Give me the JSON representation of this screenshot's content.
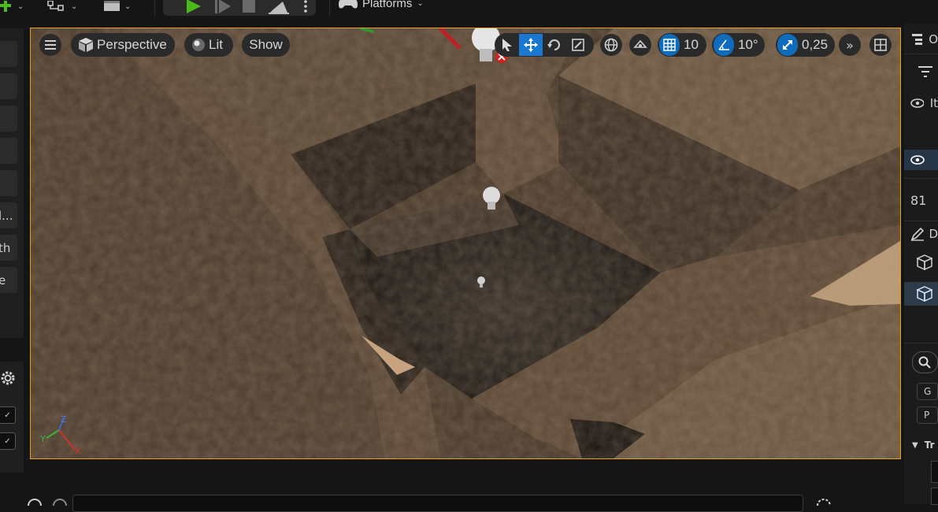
{
  "toolbar": {
    "platforms_label": "Platforms"
  },
  "viewport": {
    "view_mode": "Perspective",
    "lighting_mode": "Lit",
    "show_label": "Show",
    "grid_snap_value": "10",
    "rotation_snap_value": "10°",
    "scale_snap_value": "0,25",
    "axis_labels": {
      "x": "X",
      "y": "Y",
      "z": "Z"
    }
  },
  "left_panel": {
    "items": [
      {
        "label": ""
      },
      {
        "label": ""
      },
      {
        "label": ""
      },
      {
        "label": ""
      },
      {
        "label": ""
      },
      {
        "label": "l..."
      },
      {
        "label": "th"
      },
      {
        "label": "e"
      }
    ]
  },
  "right_panel": {
    "row_texts": {
      "tab_cut": "O",
      "visibility_cut": "It",
      "count": "81",
      "details_cut": "D",
      "btn_g": "G",
      "btn_p": "P",
      "transform_cut": "Tr"
    }
  },
  "colors": {
    "accent_selection": "#e8a019",
    "active_blue": "#0f6cbd",
    "play_green": "#4cbb17"
  }
}
